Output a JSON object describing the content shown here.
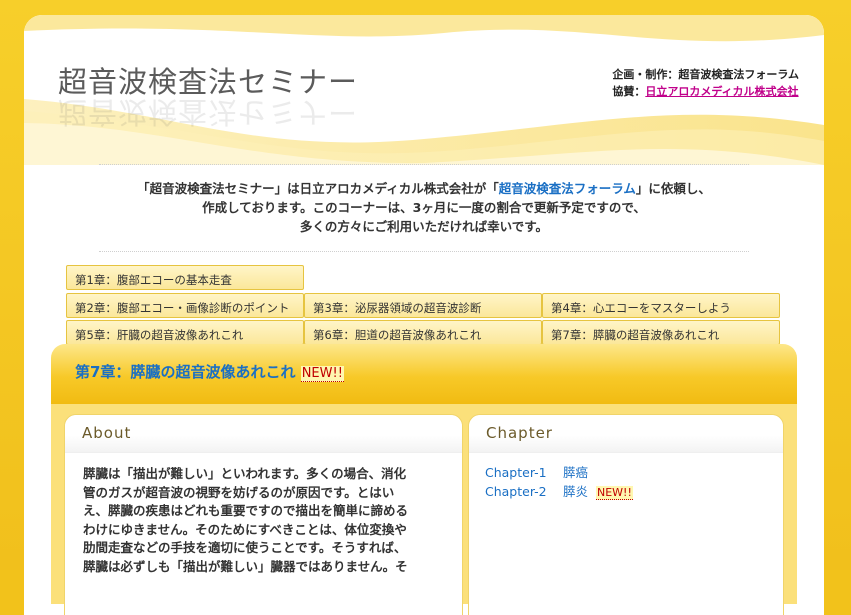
{
  "site": {
    "title": "超音波検査法セミナー",
    "credits_line1": "企画・制作：超音波検査法フォーラム",
    "credits_line2_prefix": "協賛：",
    "credits_line2_link": "日立アロカメディカル株式会社"
  },
  "intro": {
    "line1_a": "「超音波検査法セミナー」は日立アロカメディカル株式会社が「",
    "line1_link": "超音波検査法フォーラム",
    "line1_b": "」に依頼し、",
    "line2": "作成しております。このコーナーは、3ヶ月に一度の割合で更新予定ですので、",
    "line3": "多くの方々にご利用いただければ幸いです。"
  },
  "tabs": [
    {
      "label": "第1章：腹部エコーの基本走査"
    },
    {
      "label": "第2章：腹部エコー・画像診断のポイント"
    },
    {
      "label": "第3章：泌尿器領域の超音波診断"
    },
    {
      "label": "第4章：心エコーをマスターしよう"
    },
    {
      "label": "第5章：肝臓の超音波像あれこれ"
    },
    {
      "label": "第6章：胆道の超音波像あれこれ"
    },
    {
      "label": "第7章：膵臓の超音波像あれこれ"
    }
  ],
  "current": {
    "title": "第7章：膵臓の超音波像あれこれ",
    "badge": "NEW!!"
  },
  "about": {
    "heading": "About",
    "lines": [
      "膵臓は「描出が難しい」といわれます。多くの場合、消化",
      "管のガスが超音波の視野を妨げるのが原因です。とはい",
      "え、膵臓の疾患はどれも重要ですので描出を簡単に諦める",
      "わけにゆきません。そのためにすべきことは、体位変換や",
      "肋間走査などの手技を適切に使うことです。そうすれば、",
      "膵臓は必ずしも「描出が難しい」臓器ではありません。そ"
    ]
  },
  "chapter": {
    "heading": "Chapter",
    "items": [
      {
        "num": "Chapter-1",
        "name": "膵癌",
        "badge": ""
      },
      {
        "num": "Chapter-2",
        "name": "膵炎",
        "badge": "NEW!!"
      }
    ]
  },
  "colors": {
    "accent_yellow": "#f2c21b",
    "link_blue": "#1a6fc4",
    "link_magenta": "#c0008a",
    "new_red": "#c00000"
  }
}
